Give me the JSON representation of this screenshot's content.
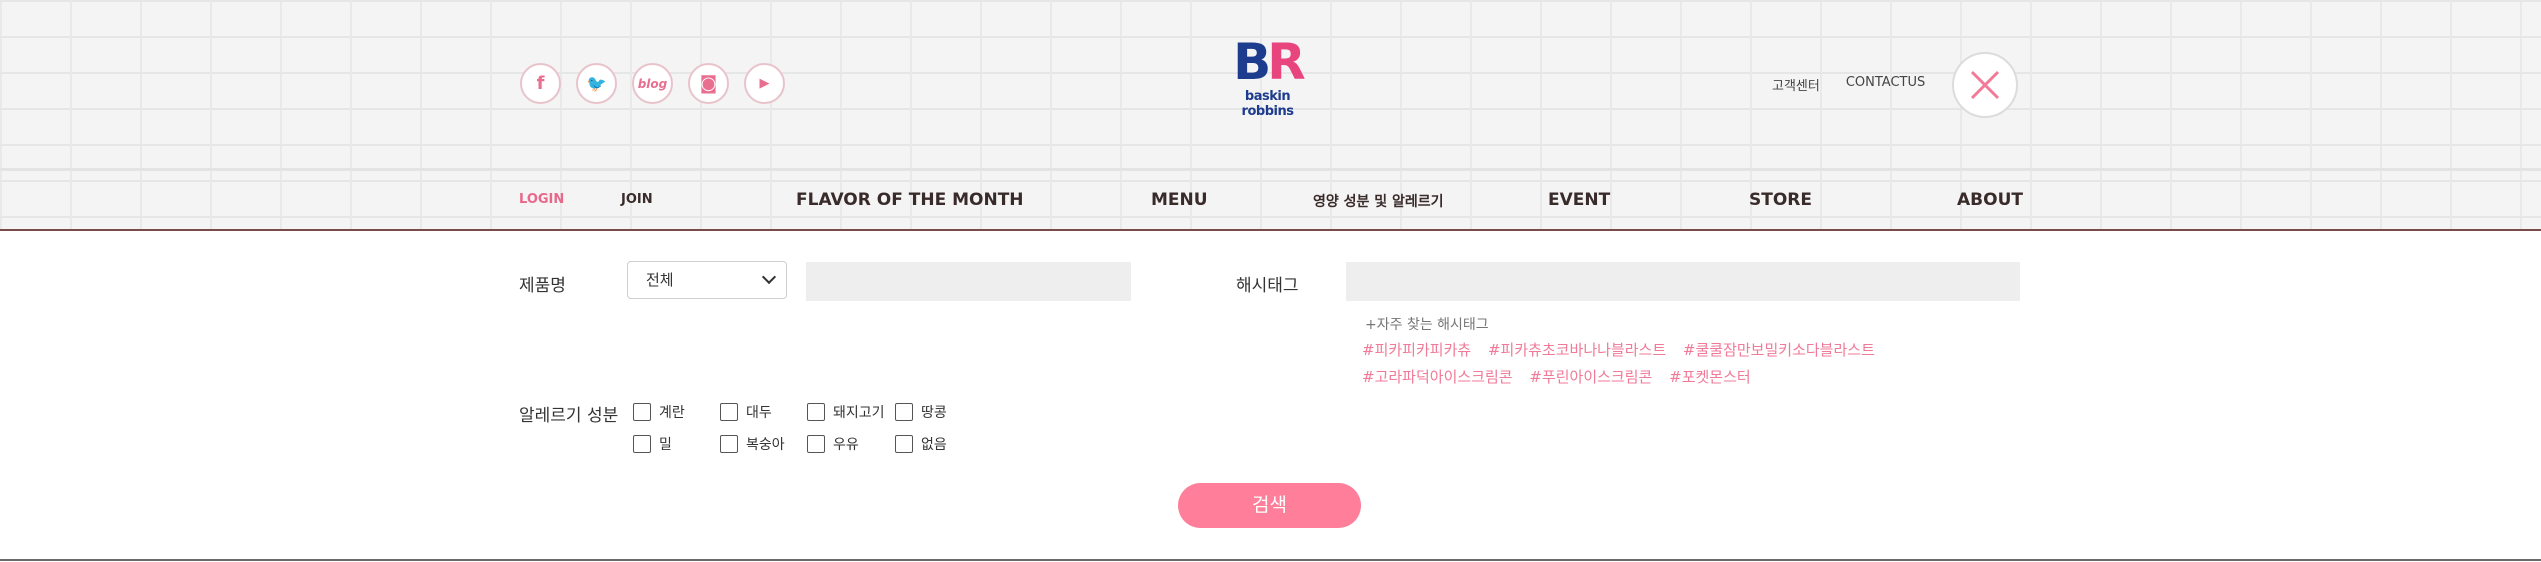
{
  "header": {
    "social_icons": [
      {
        "icon": "facebook-icon",
        "glyph": "f"
      },
      {
        "icon": "twitter-icon",
        "glyph": "🐦"
      },
      {
        "icon": "blog-icon",
        "glyph": "blog"
      },
      {
        "icon": "instagram-icon",
        "glyph": "◙"
      },
      {
        "icon": "youtube-icon",
        "glyph": "▶"
      }
    ],
    "logo": {
      "br_b": "B",
      "br_r": "R",
      "line1": "baskin",
      "line2": "robbins"
    },
    "customer_center": "고객센터",
    "contact_us": "CONTACTUS",
    "close_icon": "close-icon"
  },
  "nav": {
    "login": "LOGIN",
    "join": "JOIN",
    "flavor": "FLAVOR OF THE MONTH",
    "menu": "MENU",
    "nutrition": "영양 성분 및 알레르기",
    "event": "EVENT",
    "store": "STORE",
    "about": "ABOUT"
  },
  "search": {
    "product_label": "제품명",
    "category_select": "전체",
    "product_input_value": "",
    "hashtag_label": "해시태그",
    "hashtag_input_value": "",
    "hint": "+자주 찾는 해시태그",
    "tags_row1": [
      "#피카피카피카츄",
      "#피카츄초코바나나블라스트",
      "#쿨쿨잠만보밀키소다블라스트"
    ],
    "tags_row2": [
      "#고라파덕아이스크림콘",
      "#푸린아이스크림콘",
      "#포켓몬스터"
    ],
    "allergy_label": "알레르기 성분",
    "allergy_row1": [
      "계란",
      "대두",
      "돼지고기",
      "땅콩"
    ],
    "allergy_row2": [
      "밀",
      "복숭아",
      "우유",
      "없음"
    ],
    "submit": "검색"
  },
  "colors": {
    "accent_pink": "#ff7e9a",
    "brand_blue": "#1e3c8e",
    "brand_pink": "#e8457f"
  }
}
